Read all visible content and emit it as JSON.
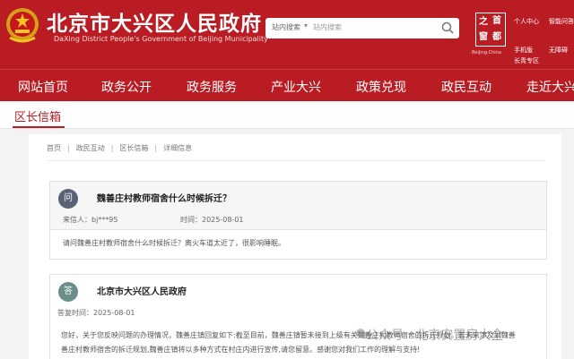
{
  "header": {
    "site_title": "北京市大兴区人民政府",
    "site_subtitle": "DaXing District People's Government of Beijing Municipality",
    "search_scope": "站内搜索",
    "search_placeholder": "站内搜索",
    "logo_chars": [
      "之",
      "首",
      "窗",
      "都"
    ],
    "logo_caption": "Beijing·China",
    "top_links": {
      "personal_center": "个人中心",
      "smart_q": "智能问答",
      "mobile": "手机版",
      "accessibility": "无障碍",
      "elder_zone": "长青专区"
    }
  },
  "nav": {
    "items": [
      "网站首页",
      "政务公开",
      "政务服务",
      "产业大兴",
      "政策兑现",
      "政民互动",
      "走近大兴"
    ]
  },
  "section": {
    "title": "区长信箱"
  },
  "breadcrumb": {
    "items": [
      "首页",
      "政民互动",
      "区长信箱",
      "详细信息"
    ]
  },
  "question": {
    "badge": "问",
    "title": "魏善庄村教师宿舍什么时候拆迁？",
    "sender_label": "来信人：",
    "sender": "bj***95",
    "time_label": "时间：",
    "time": "2025-08-01",
    "content": "请问魏善庄村教师宿舍什么时候拆迁？离火车道太近了，很影响睡眠。"
  },
  "answer": {
    "badge": "答",
    "title": "北京市大兴区人民政府",
    "time_label": "答复时间：",
    "time": "2025-08-01",
    "content_line1": "您好，关于您反映问题的办理情况，魏善庄镇回复如下:截至目前，魏善庄镇暂未接到上级有关魏善庄村教师宿舍的拆迁规划。若未来涉及到魏善",
    "content_line2": "善庄村教师宿舍的拆迁规划,魏善庄镇将以多种方式在村庄内进行宣传,请您留意。感谢您对我们工作的理解与支持!"
  },
  "watermark": {
    "text": "公众号 · 北京安置房大全"
  },
  "colors": {
    "brand_red": "#b91c22",
    "badge_q": "#5b6276",
    "badge_a": "#6b8e8a"
  }
}
